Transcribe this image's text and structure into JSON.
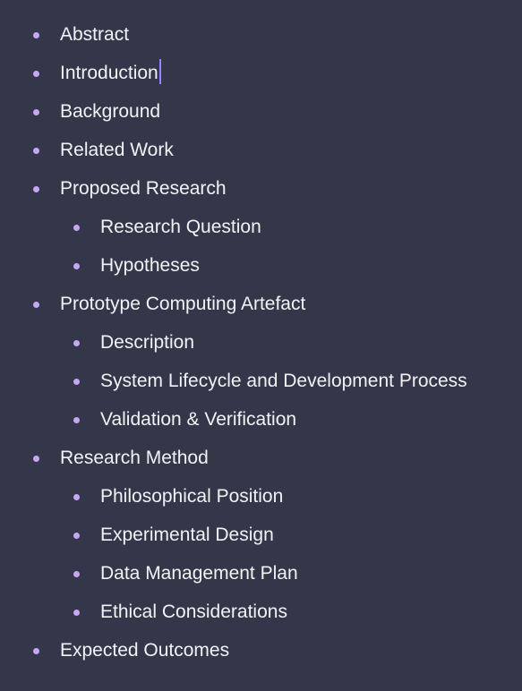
{
  "outline": {
    "items": [
      {
        "label": "Abstract",
        "level": 0
      },
      {
        "label": "Introduction",
        "level": 0
      },
      {
        "label": "Background",
        "level": 0
      },
      {
        "label": "Related Work",
        "level": 0
      },
      {
        "label": "Proposed Research",
        "level": 0
      },
      {
        "label": "Research Question",
        "level": 1
      },
      {
        "label": "Hypotheses",
        "level": 1
      },
      {
        "label": "Prototype Computing Artefact",
        "level": 0
      },
      {
        "label": "Description",
        "level": 1
      },
      {
        "label": "System Lifecycle and Development Process",
        "level": 1
      },
      {
        "label": "Validation & Verification",
        "level": 1
      },
      {
        "label": "Research Method",
        "level": 0
      },
      {
        "label": "Philosophical Position",
        "level": 1
      },
      {
        "label": "Experimental Design",
        "level": 1
      },
      {
        "label": "Data Management Plan",
        "level": 1
      },
      {
        "label": "Ethical Considerations",
        "level": 1
      },
      {
        "label": "Expected Outcomes",
        "level": 0
      }
    ]
  },
  "colors": {
    "background": "#34374a",
    "text": "#f2f2f5",
    "bullet": "#c7a6f5",
    "caret": "#8f86ff"
  },
  "icons": {
    "bullet": "bullet-dot-icon",
    "cursor": "text-cursor-icon"
  }
}
